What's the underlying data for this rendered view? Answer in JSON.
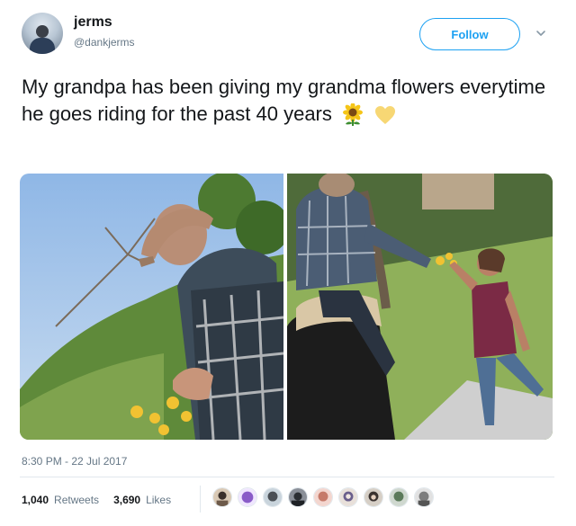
{
  "tweet": {
    "author_name": "jerms",
    "author_handle": "@dankjerms",
    "follow_label": "Follow",
    "text": "My grandpa has been giving my grandma flowers everytime he goes riding for the past 40 years",
    "emojis": [
      "sunflower-emoji",
      "yellow-heart-emoji"
    ],
    "timestamp": "8:30 PM - 22 Jul 2017",
    "retweets_count": "1,040",
    "retweets_label": "Retweets",
    "likes_count": "3,690",
    "likes_label": "Likes"
  },
  "colors": {
    "accent": "#1da1f2",
    "secondary_text": "#657786",
    "primary_text": "#14171a",
    "divider": "#e1e8ed"
  },
  "icons": {
    "more": "chevron-down-icon"
  },
  "likers_count": 9
}
